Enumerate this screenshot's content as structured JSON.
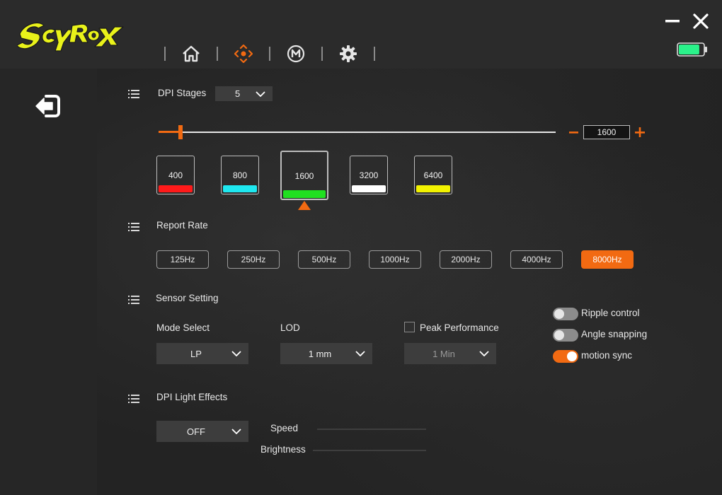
{
  "app": {
    "brand_logo": "Scyrox",
    "nav": [
      {
        "name": "home",
        "icon": "home-icon",
        "active": false
      },
      {
        "name": "dpi",
        "icon": "crosshair-icon",
        "active": true
      },
      {
        "name": "macro",
        "icon": "macro-m-icon",
        "active": false
      },
      {
        "name": "settings",
        "icon": "gear-icon",
        "active": false
      }
    ],
    "accent_color": "#f26a12",
    "battery_level": 0.85
  },
  "dpi_stages": {
    "title": "DPI Stages",
    "count_selected": "5",
    "current_value": "1600",
    "slider_fraction": 0.055,
    "stages": [
      {
        "value": "400",
        "color": "#ff1a1a"
      },
      {
        "value": "800",
        "color": "#1ee8f0"
      },
      {
        "value": "1600",
        "color": "#20e020",
        "selected": true
      },
      {
        "value": "3200",
        "color": "#ffffff"
      },
      {
        "value": "6400",
        "color": "#f2f200"
      }
    ]
  },
  "report_rate": {
    "title": "Report Rate",
    "options": [
      "125Hz",
      "250Hz",
      "500Hz",
      "1000Hz",
      "2000Hz",
      "4000Hz",
      "8000Hz"
    ],
    "selected": "8000Hz"
  },
  "sensor": {
    "title": "Sensor Setting",
    "mode_label": "Mode Select",
    "mode_value": "LP",
    "lod_label": "LOD",
    "lod_value": "1 mm",
    "peak_label": "Peak Performance",
    "peak_checked": false,
    "peak_value": "1 Min",
    "toggles": [
      {
        "label": "Ripple control",
        "on": false
      },
      {
        "label": "Angle snapping",
        "on": false
      },
      {
        "label": "motion sync",
        "on": true
      }
    ]
  },
  "light": {
    "title": "DPI Light Effects",
    "effect_value": "OFF",
    "speed_label": "Speed",
    "brightness_label": "Brightness"
  }
}
